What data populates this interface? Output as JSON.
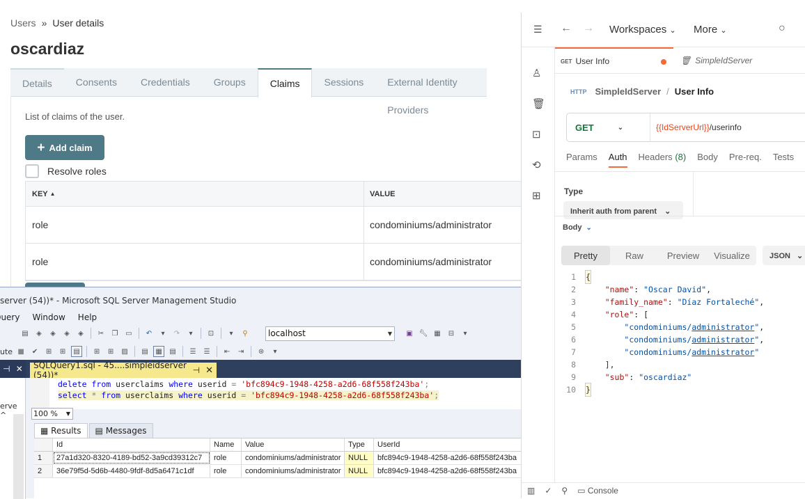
{
  "admin": {
    "breadcrumb": {
      "parent": "Users",
      "sep": "»",
      "current": "User details"
    },
    "title": "oscardiaz",
    "tabs": [
      "Details",
      "Consents",
      "Credentials",
      "Groups",
      "Claims",
      "Sessions",
      "External Identity Providers"
    ],
    "active_tab": "Claims",
    "description": "List of claims of the user.",
    "add_claim_label": "Add claim",
    "resolve_roles_label": "Resolve roles",
    "table": {
      "headers": {
        "key": "KEY",
        "value": "VALUE"
      },
      "rows": [
        {
          "key": "role",
          "value": "condominiums/administrator"
        },
        {
          "key": "role",
          "value": "condominiums/administrator"
        }
      ]
    }
  },
  "ssms": {
    "title": "server (54))* - Microsoft SQL Server Management Studio",
    "menu": [
      "Query",
      "Window",
      "Help"
    ],
    "server": "localhost",
    "left_label_execute": "ute",
    "query_tab": "SQLQuery1.sql - 45....simpleidserver (54))*",
    "pin_glyph": "⊣",
    "close_glyph": "✕",
    "object_explorer_label": "erve",
    "editor": {
      "line1": {
        "kw1": "delete",
        "kw2": "from",
        "tbl": "userclaims",
        "kw3": "where",
        "col": "userid",
        "op": "=",
        "val": "'bfc894c9-1948-4258-a2d6-68f558f243ba'",
        "end": ";"
      },
      "line2": {
        "kw1": "select",
        "star": "*",
        "kw2": "from",
        "tbl": "userclaims",
        "kw3": "where",
        "col": "userid",
        "op": "=",
        "val": "'bfc894c9-1948-4258-a2d6-68f558f243ba'",
        "end": ";"
      }
    },
    "zoom": "100 %",
    "results_tab": "Results",
    "messages_tab": "Messages",
    "grid": {
      "headers": [
        "Id",
        "Name",
        "Value",
        "Type",
        "UserId"
      ],
      "rows": [
        [
          "1",
          "27a1d320-8320-4189-bd52-3a9cd39312c7",
          "role",
          "condominiums/administrator",
          "NULL",
          "bfc894c9-1948-4258-a2d6-68f558f243ba"
        ],
        [
          "2",
          "36e79f5d-5d6b-4480-9fdf-8d5a6471c1df",
          "role",
          "condominiums/administrator",
          "NULL",
          "bfc894c9-1948-4258-a2d6-68f558f243ba"
        ]
      ]
    }
  },
  "postman": {
    "workspaces": "Workspaces",
    "more": "More",
    "tab_method": "GET",
    "tab_label": "User Info",
    "tab2_label": "SimpleIdServer",
    "collection": "SimpleIdServer",
    "crumb_sep": "/",
    "request_name": "User Info",
    "http_icon": "HTTP",
    "method": "GET",
    "url_var": "{{IdServerUrl}}",
    "url_path": "/userinfo",
    "req_tabs": {
      "params": "Params",
      "auth": "Auth",
      "headers": "Headers",
      "headers_count": "(8)",
      "body": "Body",
      "prereq": "Pre-req.",
      "tests": "Tests"
    },
    "auth_type_label": "Type",
    "auth_type_value": "Inherit auth from parent",
    "body_label": "Body",
    "format_tabs": [
      "Pretty",
      "Raw",
      "Preview",
      "Visualize"
    ],
    "format": "JSON",
    "response_lines": [
      {
        "n": "1",
        "text": "{"
      },
      {
        "n": "2",
        "key": "\"name\"",
        "val": "\"Oscar David\"",
        "tail": ","
      },
      {
        "n": "3",
        "key": "\"family_name\"",
        "val": "\"Díaz Fortaleché\"",
        "tail": ","
      },
      {
        "n": "4",
        "key": "\"role\"",
        "tail": ": ["
      },
      {
        "n": "5",
        "arr": "\"condominiums/administrator\"",
        "tail": ","
      },
      {
        "n": "6",
        "arr": "\"condominiums/administrator\"",
        "tail": ","
      },
      {
        "n": "7",
        "arr": "\"condominiums/administrator\"",
        "tail": ""
      },
      {
        "n": "8",
        "text": "],",
        "indent": "    "
      },
      {
        "n": "9",
        "key": "\"sub\"",
        "val": "\"oscardiaz\"",
        "tail": ""
      },
      {
        "n": "10",
        "text": "}"
      }
    ],
    "console_label": "Console"
  },
  "colors": {
    "teal": "#4d7a86",
    "postman_orange": "#f26b3a",
    "get_green": "#0f7b3b",
    "ssms_navy": "#2f3f5e",
    "tab_yellow": "#f6e98d"
  }
}
